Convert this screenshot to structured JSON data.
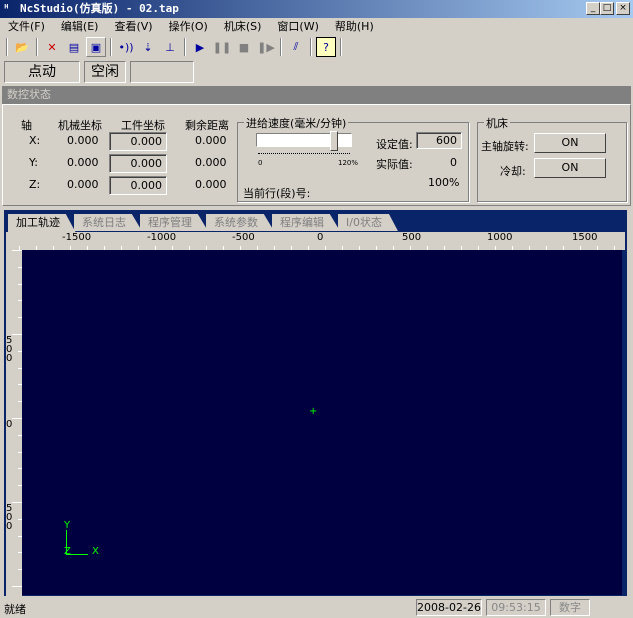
{
  "window": {
    "title": "NcStudio(仿真版) - 02.tap",
    "min": "_",
    "max": "□",
    "close": "×"
  },
  "menu": [
    "文件(F)",
    "编辑(E)",
    "查看(V)",
    "操作(O)",
    "机床(S)",
    "窗口(W)",
    "帮助(H)"
  ],
  "toolbar": {
    "icons": [
      "open-folder-icon",
      "close-file-icon",
      "window-icon",
      "display-icon",
      "signal-icon",
      "jog-icon",
      "tool-icon",
      "play-icon",
      "pause-icon",
      "stop-icon",
      "step-icon",
      "link-icon",
      "help-icon"
    ]
  },
  "mode": {
    "mode": "点动",
    "state": "空闲",
    "extra": ""
  },
  "section_title": "数控状态",
  "coords": {
    "headers": [
      "轴",
      "机械坐标",
      "工件坐标",
      "剩余距离"
    ],
    "rows": [
      {
        "axis": "X:",
        "machine": "0.000",
        "work": "0.000",
        "remain": "0.000"
      },
      {
        "axis": "Y:",
        "machine": "0.000",
        "work": "0.000",
        "remain": "0.000"
      },
      {
        "axis": "Z:",
        "machine": "0.000",
        "work": "0.000",
        "remain": "0.000"
      }
    ]
  },
  "feed": {
    "title": "进给速度(毫米/分钟)",
    "slider_min": "0",
    "slider_max": "120%",
    "slider_value_percent": 100,
    "set_label": "设定值:",
    "set_value": "600",
    "actual_label": "实际值:",
    "actual_value": "0",
    "percent": "100%",
    "line_label": "当前行(段)号:"
  },
  "machine": {
    "title": "机床",
    "spindle_label": "主轴旋转:",
    "spindle_btn": "ON",
    "coolant_label": "冷却:",
    "coolant_btn": "ON"
  },
  "tabs": [
    "加工轨迹",
    "系统日志",
    "程序管理",
    "系统参数",
    "程序编辑",
    "I/0状态"
  ],
  "ruler": {
    "x_labels": [
      "-1500",
      "-1000",
      "-500",
      "0",
      "500",
      "1000",
      "1500"
    ],
    "y_labels": [
      "500",
      "0",
      "-500"
    ]
  },
  "axes_indicator": {
    "y": "Y",
    "z": "Z",
    "x": "X"
  },
  "statusbar": {
    "text": "就绪",
    "date": "2008-02-26",
    "time": "09:53:15",
    "mode": "数字"
  },
  "colors": {
    "canvas": "#000040",
    "axis": "#00ff00",
    "title": "#0a246a"
  }
}
